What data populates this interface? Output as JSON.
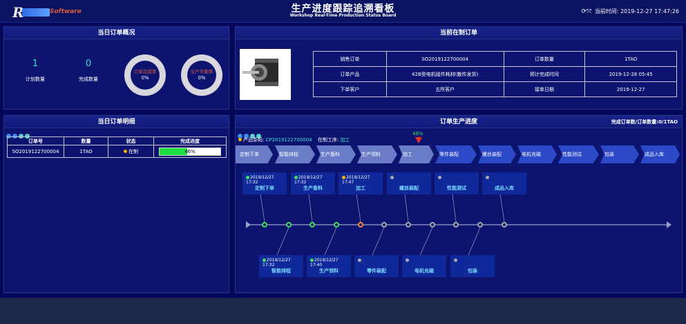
{
  "header": {
    "logo_letter": "R",
    "logo_text": "Software",
    "title_cn": "生产进度跟踪追溯看板",
    "title_en": "Workshop Real-Time Production Status Board",
    "clock_label": "当前时间:",
    "clock_value": "2019-12-27 17:47:26",
    "fullscreen_icon": "expand-icon"
  },
  "overview": {
    "title": "当日订单概况",
    "plan_count": "1",
    "plan_label": "计划数量",
    "done_count": "0",
    "done_label": "完成数量",
    "ring1_label": "订单完成率",
    "ring1_value": "0%",
    "ring2_label": "生产平衡率",
    "ring2_value": "0%"
  },
  "current_order": {
    "title": "当前在制订单",
    "rows": [
      [
        "销售订单",
        "SO2019122700004",
        "订单数量",
        "1TAO"
      ],
      [
        "订单产品",
        "42B型电机组件耗材(散件发货)",
        "预计完成时间",
        "2019-12-28 05:45"
      ],
      [
        "下单客户",
        "五所客户",
        "接单日期",
        "2019-12-27"
      ]
    ]
  },
  "details": {
    "title": "当日订单明细",
    "headers": [
      "订单号",
      "数量",
      "状态",
      "完成进度"
    ],
    "row": {
      "order": "SO2019122700004",
      "qty": "1TAO",
      "status": "在制",
      "progress_text": "46%",
      "progress": 0.46
    }
  },
  "progress": {
    "title": "订单生产进度",
    "summary": "完成订单数/订单数量:0/1TAO",
    "barcode_label": "产品条码:",
    "barcode": "CP2019122700004",
    "process_label": "在制工序:",
    "process": "加工",
    "marker_value": "46%",
    "steps": [
      "定制下单",
      "智能排程",
      "生产备料",
      "生产领料",
      "加工",
      "零件装配",
      "螺丝装配",
      "电机充磁",
      "性能测试",
      "包装",
      "成品入库"
    ],
    "top_cards": [
      {
        "time": "2019/12/27 17:32",
        "name": "定制下单",
        "dot": "#3fe05a"
      },
      {
        "time": "2019/12/27 17:32",
        "name": "生产备料",
        "dot": "#3fe05a"
      },
      {
        "time": "2019/12/27 17:47",
        "name": "加工",
        "dot": "#f5b400"
      },
      {
        "time": "",
        "name": "螺丝装配",
        "dot": "#aaaaaa"
      },
      {
        "time": "",
        "name": "性能测试",
        "dot": "#aaaaaa"
      },
      {
        "time": "",
        "name": "成品入库",
        "dot": "#aaaaaa"
      }
    ],
    "bottom_cards": [
      {
        "time": "2019/12/27 17:32",
        "name": "智能排程",
        "dot": "#3fe05a"
      },
      {
        "time": "2019/12/27 17:40",
        "name": "生产领料",
        "dot": "#3fe05a"
      },
      {
        "time": "",
        "name": "零件装配",
        "dot": "#aaaaaa"
      },
      {
        "time": "",
        "name": "电机充磁",
        "dot": "#aaaaaa"
      },
      {
        "time": "",
        "name": "包装",
        "dot": "#aaaaaa"
      }
    ]
  },
  "colors": {
    "done": "#3fe05a",
    "current": "#f5b400",
    "pending": "#aaaaaa",
    "accent": "#3fe0d0"
  }
}
